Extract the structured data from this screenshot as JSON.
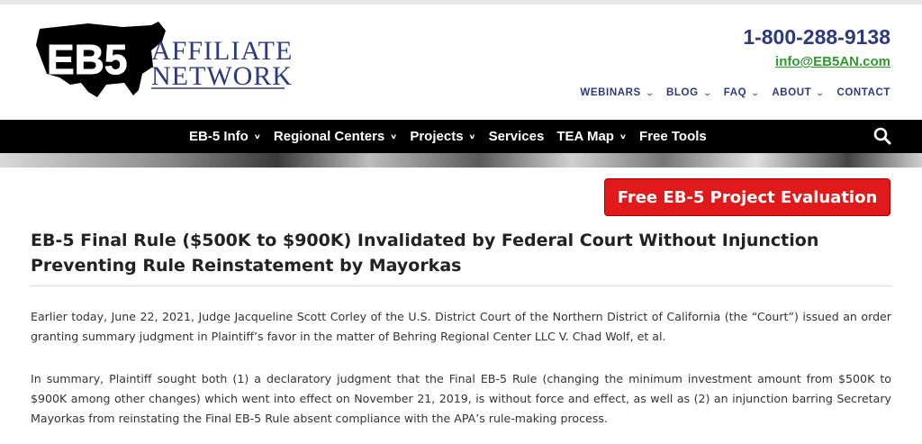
{
  "header": {
    "logo": {
      "mark": "EB5",
      "word1": "AFFILIATE",
      "word2": "NETWORK"
    },
    "phone": "1-800-288-9138",
    "email": "info@EB5AN.com",
    "top_nav": [
      {
        "label": "WEBINARS",
        "has_dropdown": true
      },
      {
        "label": "BLOG",
        "has_dropdown": true
      },
      {
        "label": "FAQ",
        "has_dropdown": true
      },
      {
        "label": "ABOUT",
        "has_dropdown": true
      },
      {
        "label": "CONTACT",
        "has_dropdown": false
      }
    ]
  },
  "main_nav": {
    "items": [
      {
        "label": "EB-5 Info",
        "has_dropdown": true
      },
      {
        "label": "Regional Centers",
        "has_dropdown": true
      },
      {
        "label": "Projects",
        "has_dropdown": true
      },
      {
        "label": "Services",
        "has_dropdown": false
      },
      {
        "label": "TEA Map",
        "has_dropdown": true
      },
      {
        "label": "Free Tools",
        "has_dropdown": false
      }
    ],
    "search_icon": "search-icon"
  },
  "cta": {
    "label": "Free EB-5 Project Evaluation"
  },
  "article": {
    "title": "EB-5 Final Rule ($500K to $900K) Invalidated by Federal Court Without Injunction Preventing Rule Reinstatement by Mayorkas",
    "paragraphs": [
      "Earlier today, June 22, 2021, Judge Jacqueline Scott Corley of the U.S. District Court of the Northern District of California (the “Court”) issued an order granting summary judgment in Plaintiff’s favor in the matter of Behring Regional Center LLC V. Chad Wolf, et al.",
      "In summary, Plaintiff sought both (1) a declaratory judgment that the Final EB-5 Rule (changing the minimum investment amount from $500K to $900K among other changes) which went into effect on November 21, 2019, is without force and effect, as well as (2) an injunction barring Secretary Mayorkas from reinstating the Final EB-5 Rule absent compliance with the APA’s rule-making process."
    ]
  },
  "colors": {
    "navy": "#2d3a7c",
    "green": "#2e9a2e",
    "nav_bg": "#000000",
    "cta_red": "#e01a1a"
  }
}
